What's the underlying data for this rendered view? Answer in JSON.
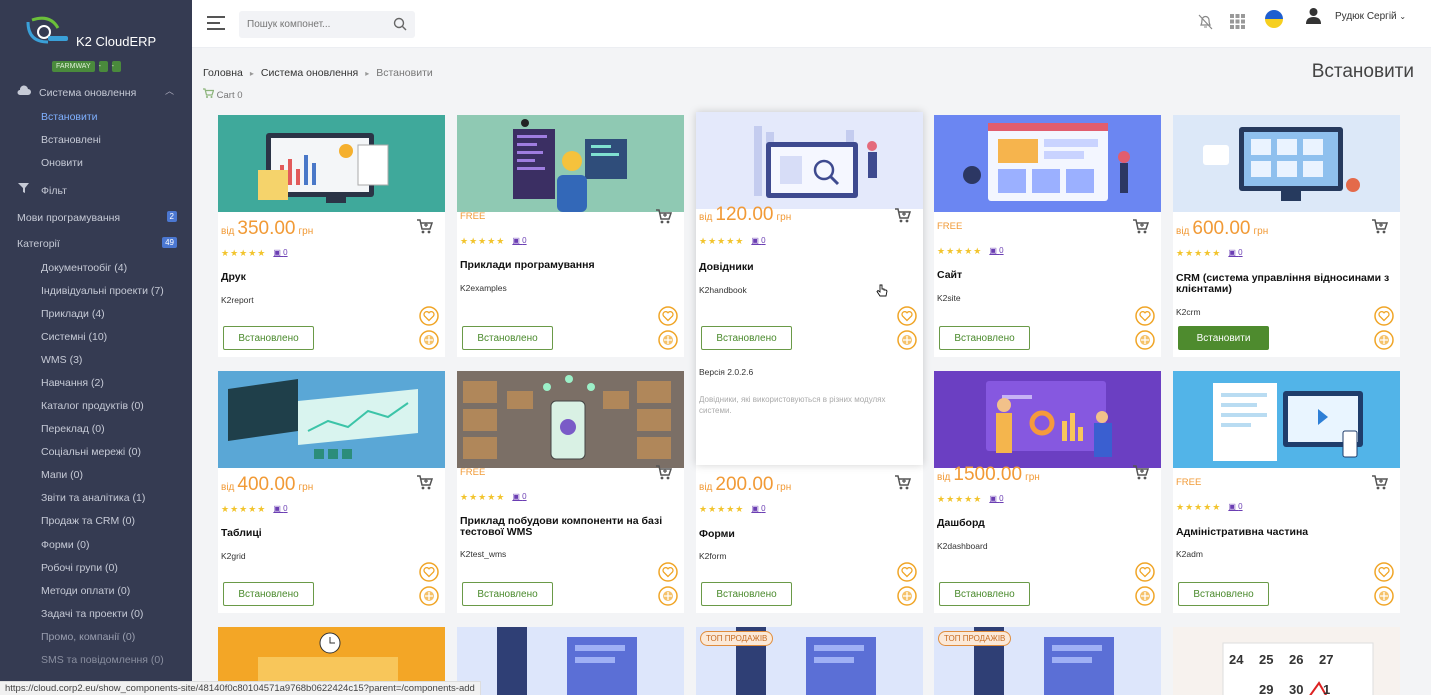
{
  "app": {
    "name": "K2 CloudERP",
    "badges": [
      "FARMWAY",
      "-",
      "-"
    ]
  },
  "sidebar": {
    "section": "Система оновлення",
    "sub_items": [
      "Встановити",
      "Встановлені",
      "Оновити"
    ],
    "filter": "Фільт",
    "languages": {
      "label": "Мови програмування",
      "count": "2"
    },
    "categories": {
      "label": "Категорії",
      "count": "49"
    },
    "category_items": [
      "Документообіг (4)",
      "Індивідуальні проекти (7)",
      "Приклади (4)",
      "Системні (10)",
      "WMS (3)",
      "Навчання (2)",
      "Каталог продуктів (0)",
      "Переклад (0)",
      "Соціальні мережі (0)",
      "Мапи (0)",
      "Звіти та аналітика (1)",
      "Продаж та CRM (0)",
      "Форми (0)",
      "Робочі групи (0)",
      "Методи оплати (0)",
      "Задачі та проекти (0)",
      "Промо, компанії (0)",
      "SMS та повідомлення (0)"
    ]
  },
  "header": {
    "search_placeholder": "Пошук компонет...",
    "user": "Рудюк Сергій",
    "accent": "#4e8b2e"
  },
  "breadcrumb": [
    "Головна",
    "Система оновлення",
    "Встановити"
  ],
  "page_title": "Встановити",
  "cart_label": "Cart 0",
  "labels": {
    "from": "від",
    "currency": "грн",
    "free": "FREE",
    "top_sales": "ТОП ПРОДАЖІВ",
    "installed": "Встановлено",
    "install": "Встановити"
  },
  "cards": [
    {
      "title": "Друк",
      "code": "K2report",
      "price": "350.00",
      "comments": "0",
      "button": "Встановлено"
    },
    {
      "title": "Приклади програмування",
      "code": "K2examples",
      "free": true,
      "comments": "0",
      "button": "Встановлено"
    },
    {
      "title": "Довідники",
      "code": "K2handbook",
      "price": "120.00",
      "comments": "0",
      "button": "Встановлено",
      "version": "Версія 2.0.2.6",
      "description": "Довідники, які використовуються в різних модулях системи."
    },
    {
      "title": "Сайт",
      "code": "K2site",
      "free": true,
      "comments": "0",
      "button": "Встановлено"
    },
    {
      "title": "CRM (система управління відносинами з клієнтами)",
      "code": "K2crm",
      "price": "600.00",
      "comments": "0",
      "button": "Встановити"
    },
    {
      "title": "Таблиці",
      "code": "K2grid",
      "price": "400.00",
      "comments": "0",
      "button": "Встановлено"
    },
    {
      "title": "Приклад побудови компоненти на базі тестової WMS",
      "code": "K2test_wms",
      "free": true,
      "comments": "0",
      "button": "Встановлено"
    },
    {
      "title": "Форми",
      "code": "K2form",
      "price": "200.00",
      "comments": "0",
      "button": "Встановлено"
    },
    {
      "title": "Дашборд",
      "code": "K2dashboard",
      "price": "1500.00",
      "comments": "0",
      "button": "Встановлено"
    },
    {
      "title": "Адміністративна частина",
      "code": "K2adm",
      "free": true,
      "comments": "0",
      "button": "Встановлено"
    }
  ],
  "calendar_days": [
    "24",
    "25",
    "26",
    "27",
    "29",
    "30",
    "1"
  ],
  "status_url": "https://cloud.corp2.eu/show_components-site/48140f0c80104571a9768b0622424c15?parent=/components-add"
}
